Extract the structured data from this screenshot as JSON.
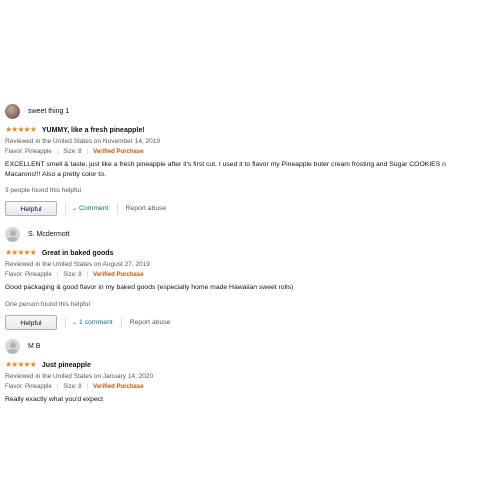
{
  "reviews": [
    {
      "name": "sweet thing 1",
      "avatar": "photo",
      "stars": "★★★★★",
      "title": "YUMMY, like a fresh pineapple!",
      "date": "Reviewed in the United States on November 14, 2019",
      "flavor": "Flavor: Pineapple",
      "size": "Size: 8",
      "verified": "Verified Purchase",
      "body": "EXCELLENT smell & taste, just like a fresh pineapple after it's first cut. I used it to flavor my Pineapple buter cream frosting and Sugar COOKIES n Macarons!!! Also a pretty color to.",
      "helpful_count": "3 people found this helpful",
      "helpful_label": "Helpful",
      "comment_label": "Comment",
      "report_label": "Report abuse"
    },
    {
      "name": "S. Mcdermott",
      "avatar": "default",
      "stars": "★★★★★",
      "title": "Great in baked goods",
      "date": "Reviewed in the United States on August 27, 2019",
      "flavor": "Flavor: Pineapple",
      "size": "Size: 8",
      "verified": "Verified Purchase",
      "body": "Good packaging & good flavor in my baked goods (especially home made Hawaiian sweet rolls)",
      "helpful_count": "One person found this helpful",
      "helpful_label": "Helpful",
      "comment_label": "1 comment",
      "report_label": "Report abuse"
    },
    {
      "name": "M B",
      "avatar": "default",
      "stars": "★★★★★",
      "title": "Just pineapple",
      "date": "Reviewed in the United States on January 14, 2020",
      "flavor": "Flavor: Pineapple",
      "size": "Size: 8",
      "verified": "Verified Purchase",
      "body": "Really exactly what you'd expect"
    }
  ],
  "colors": {
    "star": "#e8891a",
    "verified": "#c45500",
    "link": "#007185"
  },
  "rating": 5,
  "icons": [
    "avatar-icon",
    "star-icon",
    "chevron-down-icon"
  ]
}
